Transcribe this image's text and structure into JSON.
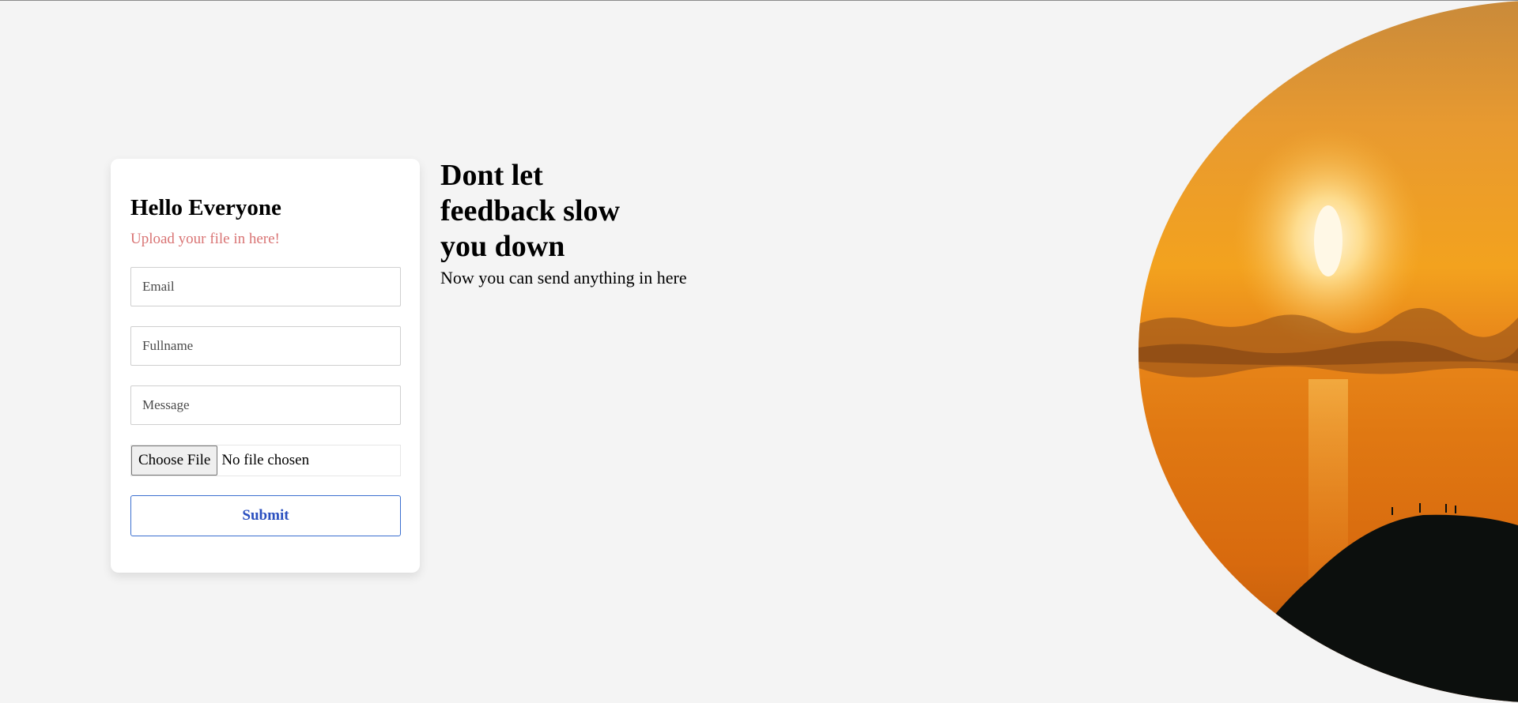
{
  "card": {
    "title": "Hello Everyone",
    "subtitle": "Upload your file in here!",
    "subtitle_color": "#d97474"
  },
  "form": {
    "email_placeholder": "Email",
    "fullname_placeholder": "Fullname",
    "message_placeholder": "Message",
    "file_button_label": "Choose File",
    "file_status": "No file chosen",
    "submit_label": "Submit",
    "submit_color": "#2a4fbf"
  },
  "hero": {
    "headline_line1": "Dont let",
    "headline_line2": "feedback slow",
    "headline_line3": "you down",
    "tagline": "Now you can send anything in here"
  },
  "image": {
    "subject": "sunset-over-water-with-hill-silhouette",
    "colors": [
      "#f0a020",
      "#e07a10",
      "#0c0f0d"
    ]
  }
}
